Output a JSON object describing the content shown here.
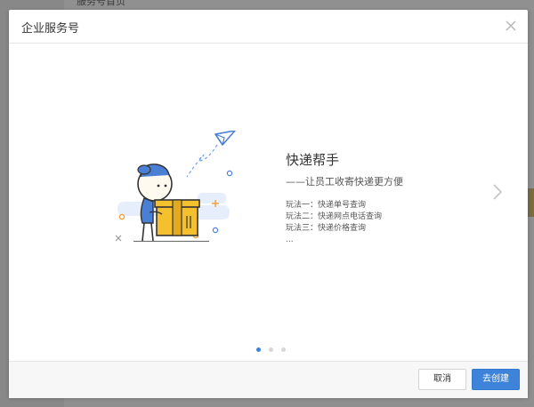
{
  "background": {
    "page_title": "服务号首页"
  },
  "modal": {
    "title": "企业服务号",
    "feature": {
      "title": "快递帮手",
      "subtitle": "——让员工收寄快递更方便",
      "items": [
        "玩法一：快递单号查询",
        "玩法二：快递网点电话查询",
        "玩法三：快递价格查询",
        "..."
      ]
    },
    "pager": {
      "total": 3,
      "active": 0
    },
    "footer": {
      "cancel_label": "取消",
      "create_label": "去创建"
    }
  },
  "colors": {
    "primary": "#3d83d9",
    "overlay": "#8e8e8e",
    "box_yellow": "#f5c02e",
    "illustration_blue": "#4a7fd6"
  },
  "icons": {
    "close": "close-icon",
    "next": "chevron-right-icon"
  }
}
